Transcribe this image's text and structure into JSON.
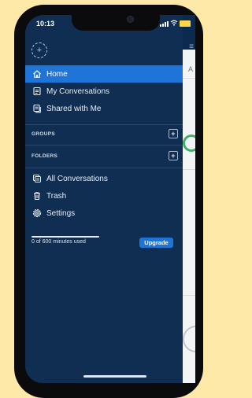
{
  "status_bar": {
    "time": "10:13"
  },
  "drawer": {
    "nav_items": [
      {
        "label": "Home",
        "icon": "home-icon",
        "active": true
      },
      {
        "label": "My Conversations",
        "icon": "document-icon",
        "active": false
      },
      {
        "label": "Shared with Me",
        "icon": "shared-document-icon",
        "active": false
      }
    ],
    "sections": [
      {
        "label": "GROUPS",
        "action_icon": "plus-icon"
      },
      {
        "label": "FOLDERS",
        "action_icon": "plus-icon"
      }
    ],
    "bottom_items": [
      {
        "label": "All Conversations",
        "icon": "stack-icon"
      },
      {
        "label": "Trash",
        "icon": "trash-icon"
      },
      {
        "label": "Settings",
        "icon": "gear-icon"
      }
    ],
    "usage": {
      "text": "0 of 600 minutes used",
      "used_fraction": 0
    },
    "upgrade_label": "Upgrade"
  },
  "background_page": {
    "partial_text": "A"
  },
  "colors": {
    "page_bg": "#FFE9A8",
    "drawer_bg": "#0f2e52",
    "accent": "#1f74d8",
    "battery": "#FFD84A"
  }
}
